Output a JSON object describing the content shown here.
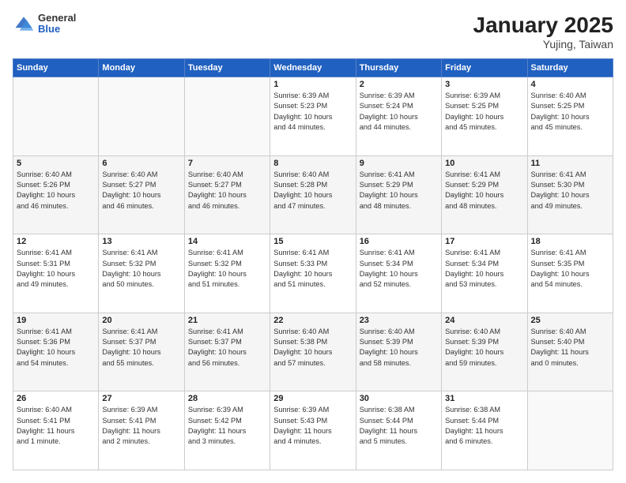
{
  "header": {
    "logo": {
      "general": "General",
      "blue": "Blue"
    },
    "title": "January 2025",
    "location": "Yujing, Taiwan"
  },
  "weekdays": [
    "Sunday",
    "Monday",
    "Tuesday",
    "Wednesday",
    "Thursday",
    "Friday",
    "Saturday"
  ],
  "weeks": [
    [
      {
        "day": "",
        "info": ""
      },
      {
        "day": "",
        "info": ""
      },
      {
        "day": "",
        "info": ""
      },
      {
        "day": "1",
        "info": "Sunrise: 6:39 AM\nSunset: 5:23 PM\nDaylight: 10 hours\nand 44 minutes."
      },
      {
        "day": "2",
        "info": "Sunrise: 6:39 AM\nSunset: 5:24 PM\nDaylight: 10 hours\nand 44 minutes."
      },
      {
        "day": "3",
        "info": "Sunrise: 6:39 AM\nSunset: 5:25 PM\nDaylight: 10 hours\nand 45 minutes."
      },
      {
        "day": "4",
        "info": "Sunrise: 6:40 AM\nSunset: 5:25 PM\nDaylight: 10 hours\nand 45 minutes."
      }
    ],
    [
      {
        "day": "5",
        "info": "Sunrise: 6:40 AM\nSunset: 5:26 PM\nDaylight: 10 hours\nand 46 minutes."
      },
      {
        "day": "6",
        "info": "Sunrise: 6:40 AM\nSunset: 5:27 PM\nDaylight: 10 hours\nand 46 minutes."
      },
      {
        "day": "7",
        "info": "Sunrise: 6:40 AM\nSunset: 5:27 PM\nDaylight: 10 hours\nand 46 minutes."
      },
      {
        "day": "8",
        "info": "Sunrise: 6:40 AM\nSunset: 5:28 PM\nDaylight: 10 hours\nand 47 minutes."
      },
      {
        "day": "9",
        "info": "Sunrise: 6:41 AM\nSunset: 5:29 PM\nDaylight: 10 hours\nand 48 minutes."
      },
      {
        "day": "10",
        "info": "Sunrise: 6:41 AM\nSunset: 5:29 PM\nDaylight: 10 hours\nand 48 minutes."
      },
      {
        "day": "11",
        "info": "Sunrise: 6:41 AM\nSunset: 5:30 PM\nDaylight: 10 hours\nand 49 minutes."
      }
    ],
    [
      {
        "day": "12",
        "info": "Sunrise: 6:41 AM\nSunset: 5:31 PM\nDaylight: 10 hours\nand 49 minutes."
      },
      {
        "day": "13",
        "info": "Sunrise: 6:41 AM\nSunset: 5:32 PM\nDaylight: 10 hours\nand 50 minutes."
      },
      {
        "day": "14",
        "info": "Sunrise: 6:41 AM\nSunset: 5:32 PM\nDaylight: 10 hours\nand 51 minutes."
      },
      {
        "day": "15",
        "info": "Sunrise: 6:41 AM\nSunset: 5:33 PM\nDaylight: 10 hours\nand 51 minutes."
      },
      {
        "day": "16",
        "info": "Sunrise: 6:41 AM\nSunset: 5:34 PM\nDaylight: 10 hours\nand 52 minutes."
      },
      {
        "day": "17",
        "info": "Sunrise: 6:41 AM\nSunset: 5:34 PM\nDaylight: 10 hours\nand 53 minutes."
      },
      {
        "day": "18",
        "info": "Sunrise: 6:41 AM\nSunset: 5:35 PM\nDaylight: 10 hours\nand 54 minutes."
      }
    ],
    [
      {
        "day": "19",
        "info": "Sunrise: 6:41 AM\nSunset: 5:36 PM\nDaylight: 10 hours\nand 54 minutes."
      },
      {
        "day": "20",
        "info": "Sunrise: 6:41 AM\nSunset: 5:37 PM\nDaylight: 10 hours\nand 55 minutes."
      },
      {
        "day": "21",
        "info": "Sunrise: 6:41 AM\nSunset: 5:37 PM\nDaylight: 10 hours\nand 56 minutes."
      },
      {
        "day": "22",
        "info": "Sunrise: 6:40 AM\nSunset: 5:38 PM\nDaylight: 10 hours\nand 57 minutes."
      },
      {
        "day": "23",
        "info": "Sunrise: 6:40 AM\nSunset: 5:39 PM\nDaylight: 10 hours\nand 58 minutes."
      },
      {
        "day": "24",
        "info": "Sunrise: 6:40 AM\nSunset: 5:39 PM\nDaylight: 10 hours\nand 59 minutes."
      },
      {
        "day": "25",
        "info": "Sunrise: 6:40 AM\nSunset: 5:40 PM\nDaylight: 11 hours\nand 0 minutes."
      }
    ],
    [
      {
        "day": "26",
        "info": "Sunrise: 6:40 AM\nSunset: 5:41 PM\nDaylight: 11 hours\nand 1 minute."
      },
      {
        "day": "27",
        "info": "Sunrise: 6:39 AM\nSunset: 5:41 PM\nDaylight: 11 hours\nand 2 minutes."
      },
      {
        "day": "28",
        "info": "Sunrise: 6:39 AM\nSunset: 5:42 PM\nDaylight: 11 hours\nand 3 minutes."
      },
      {
        "day": "29",
        "info": "Sunrise: 6:39 AM\nSunset: 5:43 PM\nDaylight: 11 hours\nand 4 minutes."
      },
      {
        "day": "30",
        "info": "Sunrise: 6:38 AM\nSunset: 5:44 PM\nDaylight: 11 hours\nand 5 minutes."
      },
      {
        "day": "31",
        "info": "Sunrise: 6:38 AM\nSunset: 5:44 PM\nDaylight: 11 hours\nand 6 minutes."
      },
      {
        "day": "",
        "info": ""
      }
    ]
  ]
}
